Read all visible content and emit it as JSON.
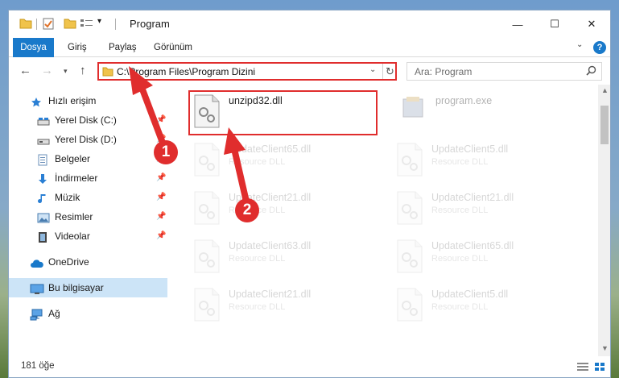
{
  "titlebar": {
    "title": "Program",
    "minimize": "—",
    "maximize": "☐",
    "close": "✕"
  },
  "ribbon": {
    "tabs": [
      "Dosya",
      "Giriş",
      "Paylaş",
      "Görünüm"
    ],
    "help": "?"
  },
  "nav": {
    "address": "C:\\Program Files\\Program Dizini",
    "search_placeholder": "Ara: Program"
  },
  "sidebar": {
    "items": [
      {
        "label": "Hızlı erişim",
        "icon": "star-icon"
      },
      {
        "label": "Yerel Disk (C:)",
        "icon": "drive-icon",
        "pinned": true
      },
      {
        "label": "Yerel Disk (D:)",
        "icon": "drive-icon",
        "pinned": true
      },
      {
        "label": "Belgeler",
        "icon": "documents-icon",
        "pinned": true
      },
      {
        "label": "İndirmeler",
        "icon": "download-icon",
        "pinned": true
      },
      {
        "label": "Müzik",
        "icon": "music-icon",
        "pinned": true
      },
      {
        "label": "Resimler",
        "icon": "pictures-icon",
        "pinned": true
      },
      {
        "label": "Videolar",
        "icon": "video-icon",
        "pinned": true
      },
      {
        "label": "OneDrive",
        "icon": "cloud-icon"
      },
      {
        "label": "Bu bilgisayar",
        "icon": "computer-icon",
        "selected": true
      },
      {
        "label": "Ağ",
        "icon": "network-icon"
      }
    ]
  },
  "files": [
    {
      "name": "unzipd32.dll",
      "type": "",
      "highlighted": true
    },
    {
      "name": "program.exe",
      "type": ""
    },
    {
      "name": "UpdateClient65.dll",
      "type": "Resource DLL"
    },
    {
      "name": "UpdateClient5.dll",
      "type": "Resource DLL"
    },
    {
      "name": "UpdateClient21.dll",
      "type": "Resource DLL"
    },
    {
      "name": "UpdateClient21.dll",
      "type": "Resource DLL"
    },
    {
      "name": "UpdateClient63.dll",
      "type": "Resource DLL"
    },
    {
      "name": "UpdateClient65.dll",
      "type": "Resource DLL"
    },
    {
      "name": "UpdateClient21.dll",
      "type": "Resource DLL"
    },
    {
      "name": "UpdateClient5.dll",
      "type": "Resource DLL"
    }
  ],
  "status": {
    "count_text": "181 öğe"
  },
  "callouts": [
    "1",
    "2"
  ],
  "colors": {
    "accent": "#1979ca",
    "highlight": "#e02d2d",
    "selected": "#cce4f7"
  }
}
